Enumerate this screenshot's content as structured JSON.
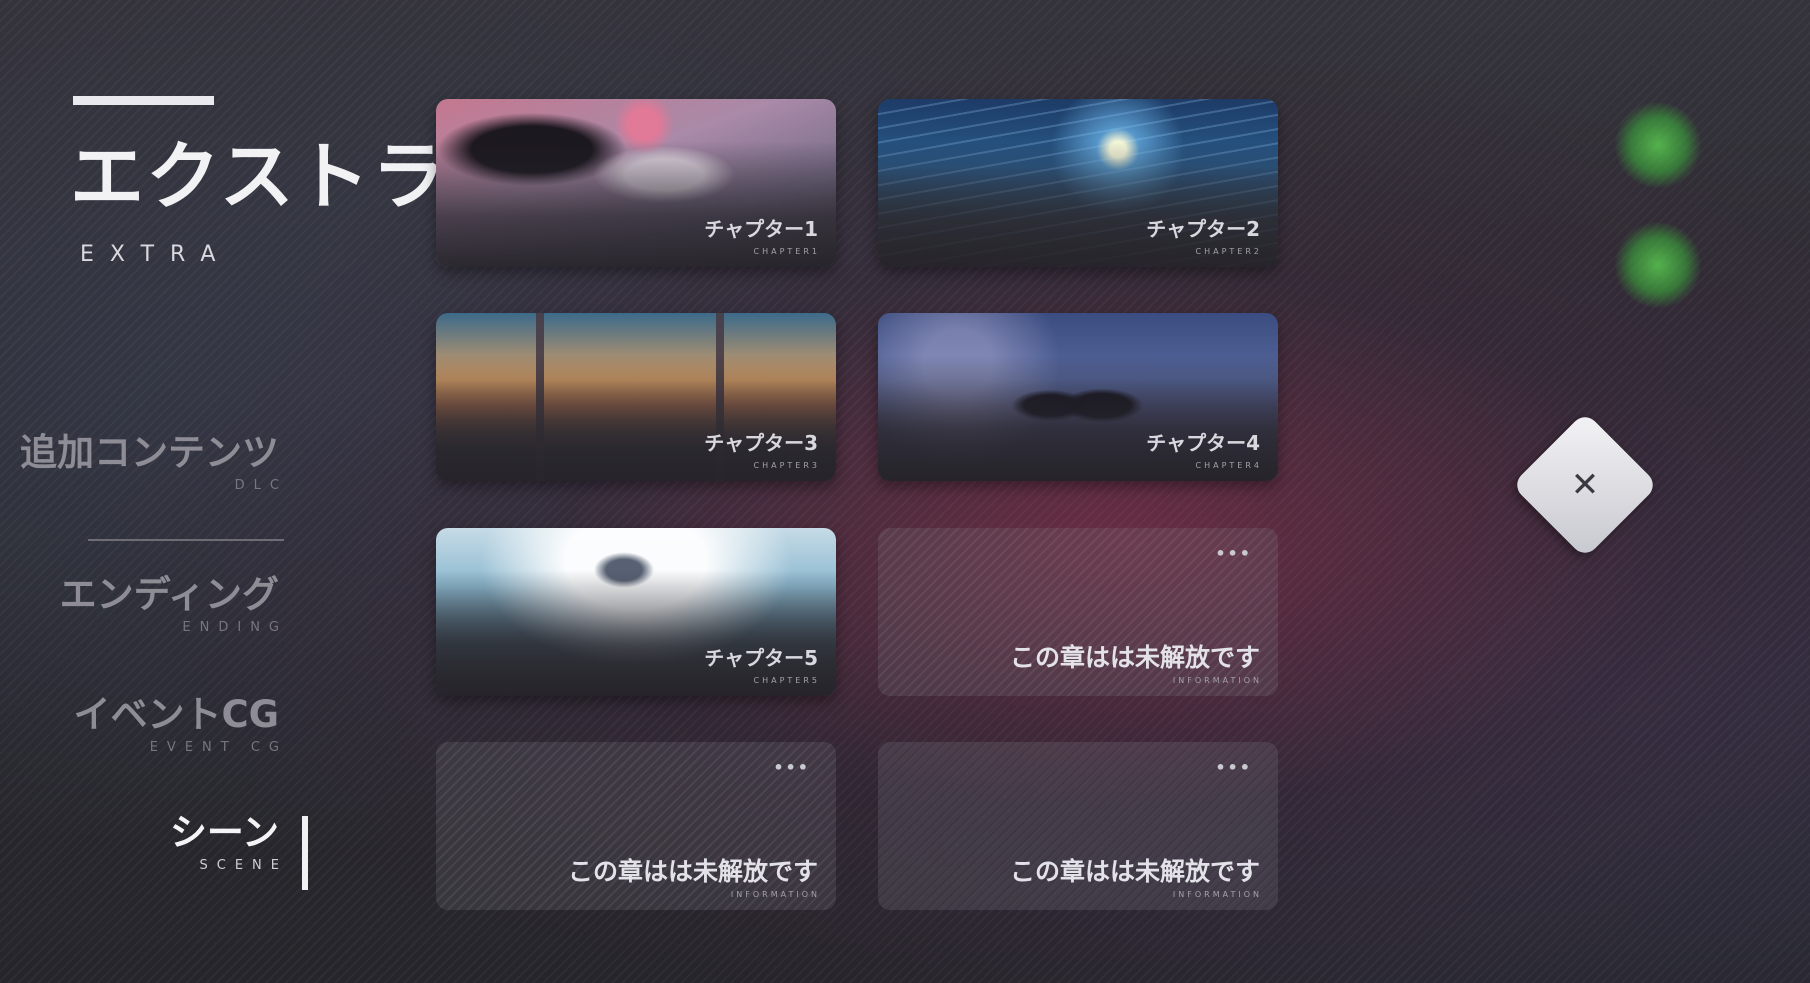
{
  "header": {
    "title_jp": "エクストラ",
    "title_en": "EXTRA"
  },
  "menu": [
    {
      "jp": "追加コンテンツ",
      "en": "DLC",
      "active": false
    },
    {
      "jp": "エンディング",
      "en": "ENDING",
      "active": false
    },
    {
      "jp": "イベントCG",
      "en": "EVENT CG",
      "active": false
    },
    {
      "jp": "シーン",
      "en": "SCENE",
      "active": true
    }
  ],
  "cards": [
    {
      "label": "チャプター1",
      "sub": "CHAPTER1",
      "locked": false
    },
    {
      "label": "チャプター2",
      "sub": "CHAPTER2",
      "locked": false
    },
    {
      "label": "チャプター3",
      "sub": "CHAPTER3",
      "locked": false
    },
    {
      "label": "チャプター4",
      "sub": "CHAPTER4",
      "locked": false
    },
    {
      "label": "チャプター5",
      "sub": "CHAPTER5",
      "locked": false
    },
    {
      "label": "この章はは未解放です",
      "sub": "INFORMATION",
      "locked": true,
      "dots": "•••"
    },
    {
      "label": "この章はは未解放です",
      "sub": "INFORMATION",
      "locked": true,
      "dots": "•••"
    },
    {
      "label": "この章はは未解放です",
      "sub": "INFORMATION",
      "locked": true,
      "dots": "•••"
    }
  ],
  "icons": {
    "close": "close-icon",
    "close_glyph": "✕"
  },
  "colors": {
    "active_text": "#f4f4f6",
    "inactive_text": "#8e8d95",
    "indicator_green": "#4cc84a"
  }
}
